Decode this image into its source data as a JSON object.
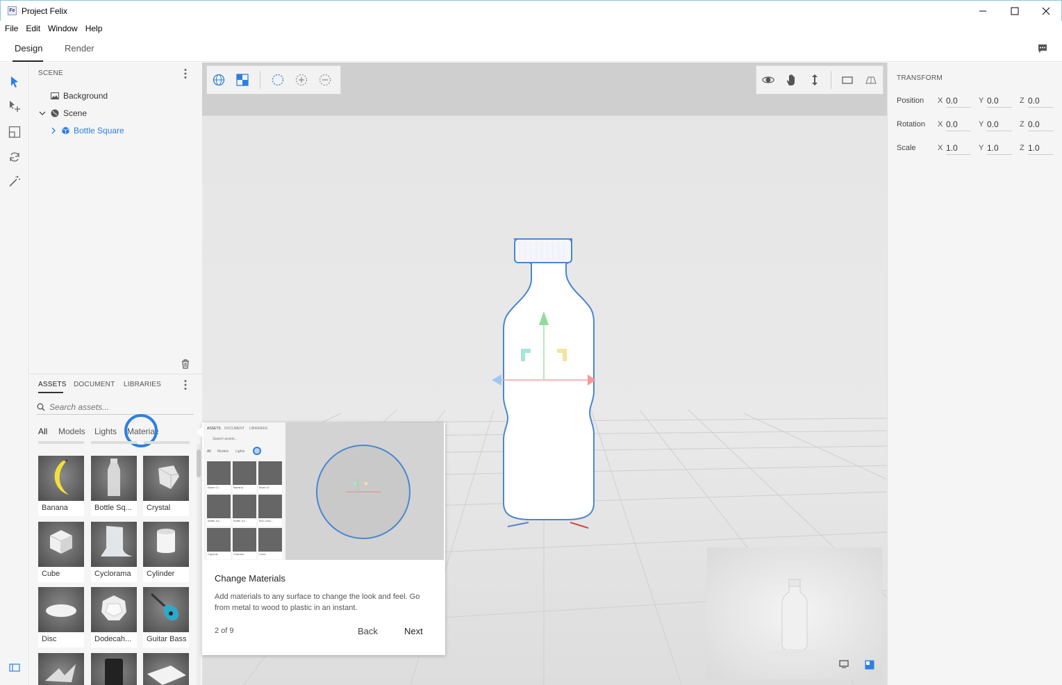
{
  "window": {
    "title": "Project Felix",
    "app_icon_text": "Fe"
  },
  "menu": [
    "File",
    "Edit",
    "Window",
    "Help"
  ],
  "modes": {
    "design": "Design",
    "render": "Render"
  },
  "scene": {
    "heading": "SCENE",
    "items": [
      {
        "label": "Background"
      },
      {
        "label": "Scene"
      },
      {
        "label": "Bottle Square"
      }
    ]
  },
  "assets": {
    "tabs": [
      "ASSETS",
      "DOCUMENT",
      "LIBRARIES"
    ],
    "search_placeholder": "Search assets...",
    "filters": [
      "All",
      "Models",
      "Lights",
      "Materials"
    ],
    "thumbs": [
      {
        "label": "Banana"
      },
      {
        "label": "Bottle Sq..."
      },
      {
        "label": "Crystal"
      },
      {
        "label": "Cube"
      },
      {
        "label": "Cyclorama"
      },
      {
        "label": "Cylinder"
      },
      {
        "label": "Disc"
      },
      {
        "label": "Dodecah..."
      },
      {
        "label": "Guitar Bass"
      }
    ]
  },
  "tour": {
    "title": "Change Materials",
    "body": "Add materials to any surface to change the look and feel. Go from metal to wood to plastic in an instant.",
    "count": "2 of 9",
    "back": "Back",
    "next": "Next",
    "mini": {
      "tabs": [
        "ASSETS",
        "DOCUMENT",
        "LIBRARIES"
      ],
      "search": "Search assets...",
      "filters": [
        "All",
        "Models",
        "Lights"
      ],
      "thumbs": [
        "Alarm Cl...",
        "Banana",
        "Book 02",
        "Bottle Jui...",
        "Bottle Jui...",
        "Box Choc...",
        "Capsule",
        "Charries",
        "Cone"
      ]
    }
  },
  "transform": {
    "heading": "TRANSFORM",
    "rows": [
      {
        "label": "Position",
        "x": "0.0",
        "y": "0.0",
        "z": "0.0"
      },
      {
        "label": "Rotation",
        "x": "0.0",
        "y": "0.0",
        "z": "0.0"
      },
      {
        "label": "Scale",
        "x": "1.0",
        "y": "1.0",
        "z": "1.0"
      }
    ],
    "axes": [
      "X",
      "Y",
      "Z"
    ]
  },
  "colors": {
    "accent": "#2d7fe0",
    "selection": "#4a86d0"
  }
}
